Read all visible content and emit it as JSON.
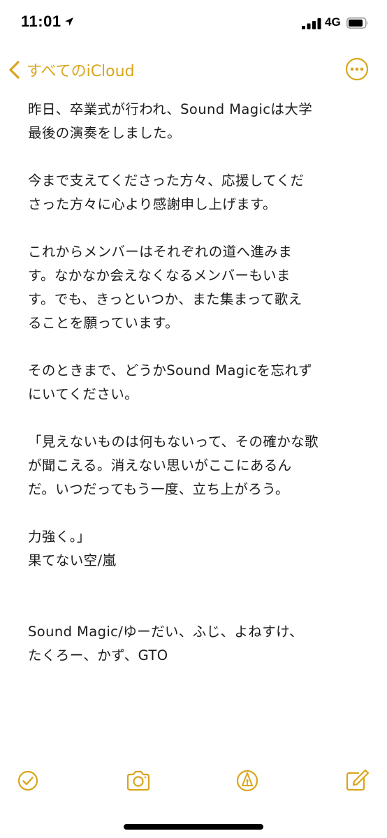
{
  "status_bar": {
    "time": "11:01",
    "network": "4G"
  },
  "nav": {
    "back_label": "すべてのiCloud"
  },
  "note": {
    "lines": [
      "昨日、卒業式が行われ、Sound Magicは大学",
      "最後の演奏をしました。",
      "",
      "今まで支えてくださった方々、応援してくだ",
      "さった方々に心より感謝申し上げます。",
      "",
      "これからメンバーはそれぞれの道へ進みま",
      "す。なかなか会えなくなるメンバーもいま",
      "す。でも、きっといつか、また集まって歌え",
      "ることを願っています。",
      "",
      "そのときまで、どうかSound Magicを忘れず",
      "にいてください。",
      "",
      "「見えないものは何もないって、その確かな歌",
      "が聞こえる。消えない思いがここにあるん",
      "だ。いつだってもう一度、立ち上がろう。",
      "",
      "力強く。」",
      "果てない空/嵐",
      "",
      "",
      "Sound Magic/ゆーだい、ふじ、よねすけ、",
      "たくろー、かず、GTO"
    ]
  },
  "colors": {
    "accent": "#d9a51c",
    "text": "#1c1c1e",
    "background": "#ffffff"
  },
  "icons": {
    "location": "location-arrow-icon",
    "signal": "cellular-signal-icon",
    "battery": "battery-icon",
    "back": "chevron-left-icon",
    "more": "ellipsis-circle-icon",
    "checklist": "checkmark-circle-icon",
    "camera": "camera-icon",
    "markup": "pen-tip-circle-icon",
    "compose": "compose-icon"
  }
}
